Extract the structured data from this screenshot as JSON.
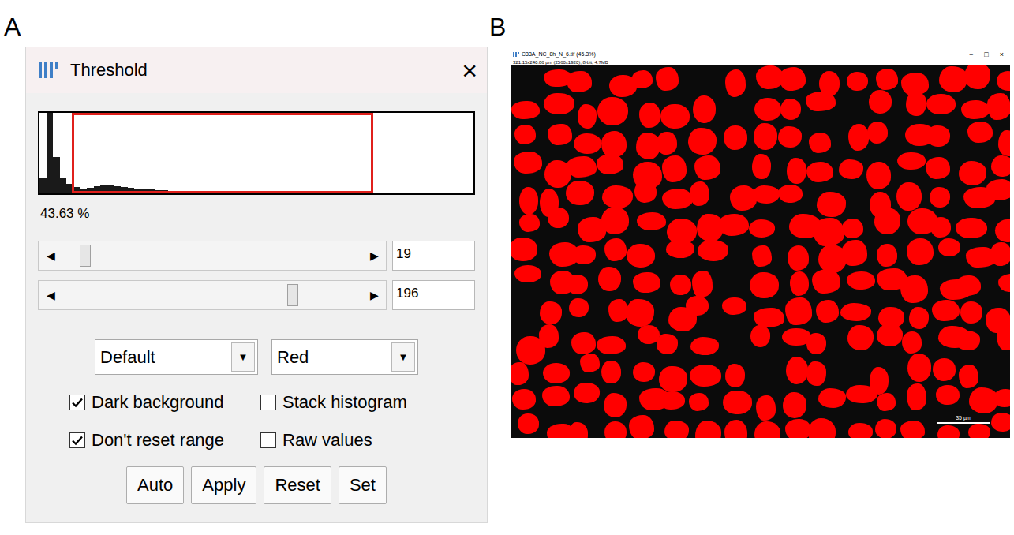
{
  "panel_labels": [
    "A",
    "B"
  ],
  "threshold_dialog": {
    "title": "Threshold",
    "close": "×",
    "histogram": {
      "values": [
        20,
        100,
        45,
        20,
        12,
        8,
        6,
        7,
        9,
        10,
        10,
        9,
        8,
        7,
        6,
        5,
        5,
        4,
        4,
        3,
        3,
        3,
        2,
        2,
        2,
        2,
        2,
        1,
        1,
        2,
        1,
        1,
        1,
        1,
        2,
        1,
        1,
        1,
        1,
        1,
        1,
        1,
        1,
        1,
        1,
        1,
        1,
        1,
        1,
        1,
        1,
        1,
        1,
        1,
        1,
        1,
        1,
        1,
        1,
        1,
        1,
        1,
        1,
        1
      ]
    },
    "percent": "43.63 %",
    "left_arrow": "◀",
    "right_arrow": "▶",
    "sliders": [
      {
        "name": "lower",
        "level": 0.075,
        "value": "19"
      },
      {
        "name": "upper",
        "level": 0.769,
        "value": "196"
      }
    ],
    "dropdown_arrow": "▼",
    "dropdowns": [
      {
        "value": "Default"
      },
      {
        "value": "Red"
      }
    ],
    "checkboxes": [
      {
        "label": "Dark background",
        "checked": true
      },
      {
        "label": "Stack histogram",
        "checked": false
      },
      {
        "label": "Don't reset range",
        "checked": true
      },
      {
        "label": "Raw values",
        "checked": false
      }
    ],
    "buttons": [
      "Auto",
      "Apply",
      "Reset",
      "Set"
    ]
  },
  "image_window": {
    "title": "C33A_NC_8h_N_6.tif (45.3%)",
    "info": "321.15x240.86 µm (2560x1920); 8-bit; 4.7MB",
    "controls": [
      "−",
      "□",
      "×"
    ],
    "scale_bar": "35 µm"
  }
}
